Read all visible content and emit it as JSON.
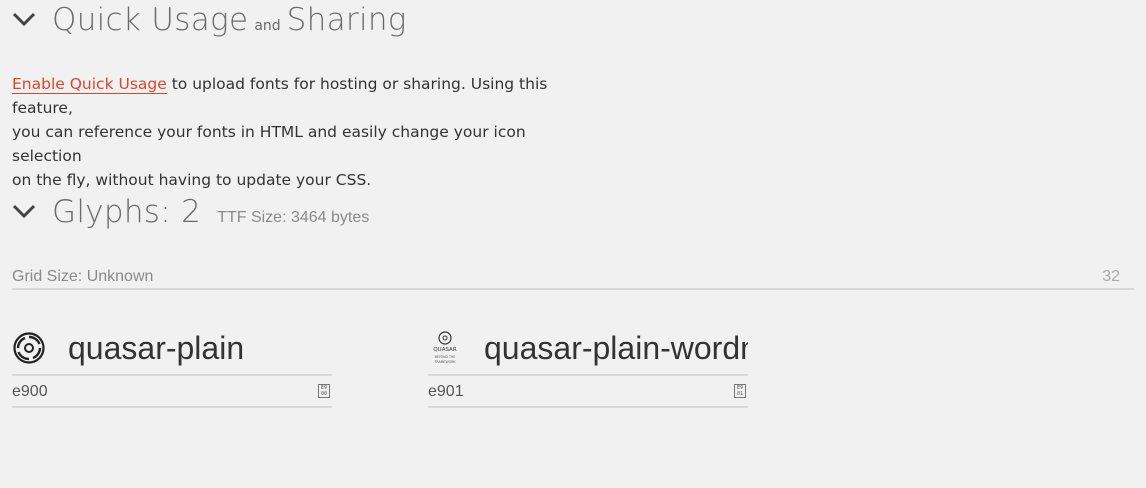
{
  "quick_usage": {
    "title_main": "Quick Usage",
    "title_and": "and",
    "title_end": "Sharing",
    "link_text": "Enable Quick Usage",
    "line1_rest": " to upload fonts for hosting or sharing. Using this feature,",
    "line2": "you can reference your fonts in HTML and easily change your icon selection",
    "line3": "on the fly, without having to update your CSS."
  },
  "glyphs": {
    "title": "Glyphs: 2",
    "ttf_size": "TTF Size: 3464 bytes",
    "grid_label": "Grid Size: Unknown",
    "grid_value": "32",
    "items": [
      {
        "name": "quasar-plain",
        "code": "e900",
        "code_top": "E9",
        "code_bottom": "00",
        "icon": "quasar-logo-icon"
      },
      {
        "name": "quasar-plain-wordmark",
        "code": "e901",
        "code_top": "E9",
        "code_bottom": "01",
        "icon": "quasar-wordmark-icon",
        "wordmark_top": "QUASAR",
        "wordmark_bottom1": "BEYOND THE",
        "wordmark_bottom2": "FRAMEWORK"
      }
    ]
  },
  "colors": {
    "link": "#d9472b",
    "background": "#f1f1f1",
    "heading": "#6b6b6b"
  }
}
